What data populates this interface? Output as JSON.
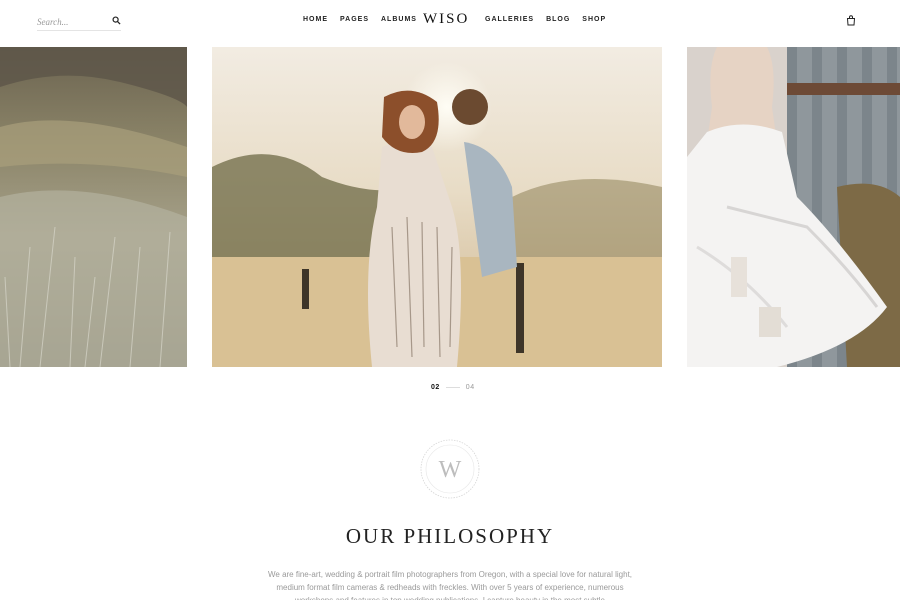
{
  "header": {
    "search": {
      "placeholder": "Search..."
    },
    "nav_left": [
      "HOME",
      "PAGES",
      "ALBUMS"
    ],
    "logo": "WISO",
    "nav_right": [
      "GALLERIES",
      "BLOG",
      "SHOP"
    ]
  },
  "slider": {
    "current": "02",
    "total": "04"
  },
  "philosophy": {
    "badge_letter": "W",
    "heading": "OUR PHILOSOPHY",
    "text": "We are fine-art, wedding & portrait film photographers from Oregon, with a special love for natural light, medium format film cameras & redheads with freckles. With over 5 years of experience, numerous workshops and features in top wedding publications, I capture beauty in the most subtle"
  },
  "colors": {
    "text_dark": "#222222",
    "text_muted": "#9a9a9a",
    "background": "#ffffff"
  }
}
